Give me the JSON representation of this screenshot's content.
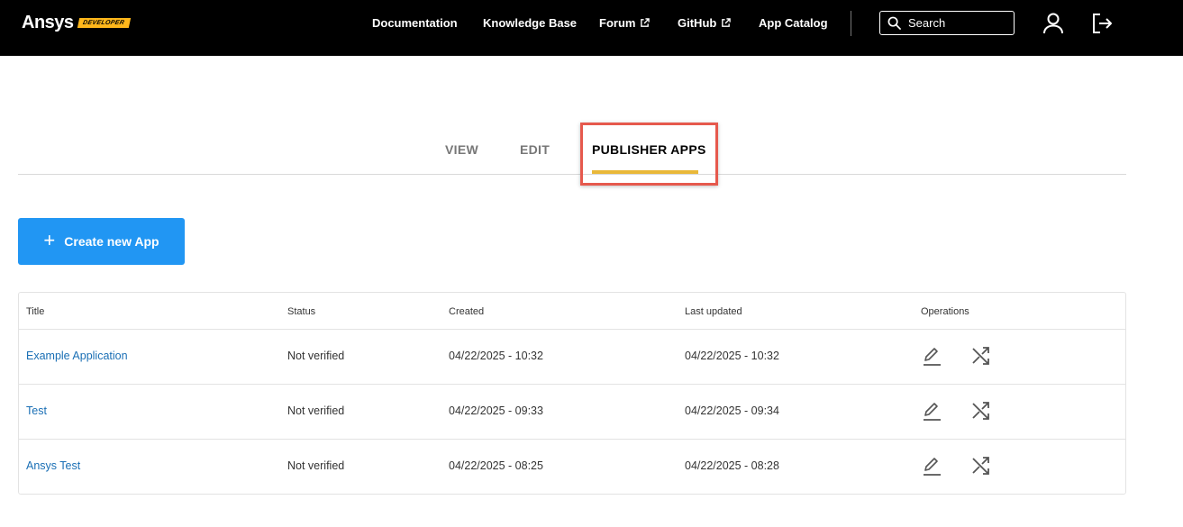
{
  "header": {
    "logo": "Ansys",
    "badge": "DEVELOPER",
    "nav": [
      {
        "label": "Documentation",
        "external": false
      },
      {
        "label": "Knowledge Base",
        "external": false
      },
      {
        "label": "Forum",
        "external": true
      },
      {
        "label": "GitHub",
        "external": true
      },
      {
        "label": "App Catalog",
        "external": false
      }
    ],
    "search_placeholder": "Search",
    "icons": [
      "search-icon",
      "user-icon",
      "logout-icon",
      "external-link-icon"
    ]
  },
  "tabs": [
    {
      "label": "VIEW",
      "active": false
    },
    {
      "label": "EDIT",
      "active": false
    },
    {
      "label": "PUBLISHER APPS",
      "active": true
    }
  ],
  "create_button": {
    "label": "Create new App",
    "icon": "plus-icon"
  },
  "table": {
    "columns": [
      "Title",
      "Status",
      "Created",
      "Last updated",
      "Operations"
    ],
    "rows": [
      {
        "title": "Example Application",
        "status": "Not verified",
        "created": "04/22/2025 - 10:32",
        "updated": "04/22/2025 - 10:32"
      },
      {
        "title": "Test",
        "status": "Not verified",
        "created": "04/22/2025 - 09:33",
        "updated": "04/22/2025 - 09:34"
      },
      {
        "title": "Ansys Test",
        "status": "Not verified",
        "created": "04/22/2025 - 08:25",
        "updated": "04/22/2025 - 08:28"
      }
    ],
    "operation_icons": [
      "edit-icon",
      "shuffle-icon"
    ]
  },
  "colors": {
    "topbar": "#000000",
    "badge": "#ffb71b",
    "accent_button": "#2196f3",
    "tab_underline": "#e9b839",
    "highlight_border": "#e6594d",
    "link": "#1a6fb5"
  }
}
